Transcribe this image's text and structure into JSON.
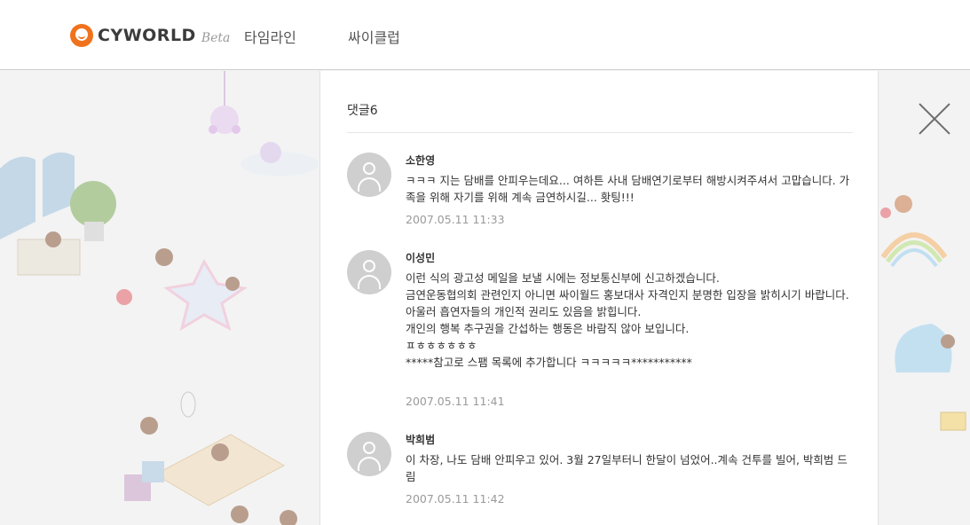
{
  "header": {
    "logo_text": "CYWORLD",
    "logo_beta": "Beta",
    "nav": [
      "타임라인",
      "싸이클럽"
    ]
  },
  "comments_panel": {
    "count_label": "댓글6",
    "comments": [
      {
        "author": "소한영",
        "text": "ㅋㅋㅋ 지는 담배를 안피우는데요... 여하튼 사내 담배연기로부터 해방시켜주셔서 고맙습니다. 가족을 위해 자기를 위해 계속 금연하시길... 홧팅!!!",
        "date": "2007.05.11 11:33"
      },
      {
        "author": "이성민",
        "text": "이런 식의 광고성 메일을 보낼 시에는 정보통신부에 신고하겠습니다.\n금연운동협의회 관련인지 아니면 싸이월드 홍보대사 자격인지 분명한 입장을 밝히시기 바랍니다.\n아울러 흡연자들의 개인적 권리도 있음을 밝힙니다.\n개인의 행복 추구권을 간섭하는 행동은 바람직 않아 보입니다.\nㅍㅎㅎㅎㅎㅎㅎ\n*****참고로 스팸 목록에 추가합니다 ㅋㅋㅋㅋㅋ***********",
        "date": "2007.05.11 11:41"
      },
      {
        "author": "박희범",
        "text": "이 차장, 나도 담배 안피우고 있어. 3월 27일부터니 한달이 넘었어..계속 건투를 빌어, 박희범 드림",
        "date": "2007.05.11 11:42"
      }
    ]
  },
  "colors": {
    "brand_orange": "#f0721c",
    "date_gray": "#9a9a9a"
  }
}
